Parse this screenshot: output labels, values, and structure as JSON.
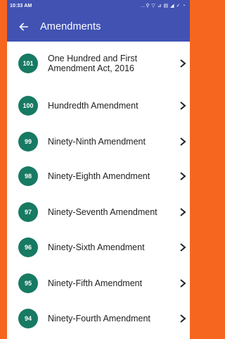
{
  "status_bar": {
    "time": "10:33 AM",
    "icons": "...⚲ ▽ ⊿ ▤ ◢ ✓ ◔"
  },
  "app_bar": {
    "title": "Amendments",
    "back_icon": "back-arrow-icon"
  },
  "colors": {
    "app_bar": "#4152b3",
    "badge": "#177a62",
    "background_frame": "#f7661e"
  },
  "amendments": [
    {
      "number": "101",
      "title": "One Hundred and First Amendment Act, 2016"
    },
    {
      "number": "100",
      "title": "Hundredth Amendment"
    },
    {
      "number": "99",
      "title": "Ninety-Ninth Amendment"
    },
    {
      "number": "98",
      "title": "Ninety-Eighth Amendment"
    },
    {
      "number": "97",
      "title": "Ninety-Seventh Amendment"
    },
    {
      "number": "96",
      "title": "Ninety-Sixth Amendment"
    },
    {
      "number": "95",
      "title": "Ninety-Fifth Amendment"
    },
    {
      "number": "94",
      "title": "Ninety-Fourth Amendment"
    }
  ]
}
